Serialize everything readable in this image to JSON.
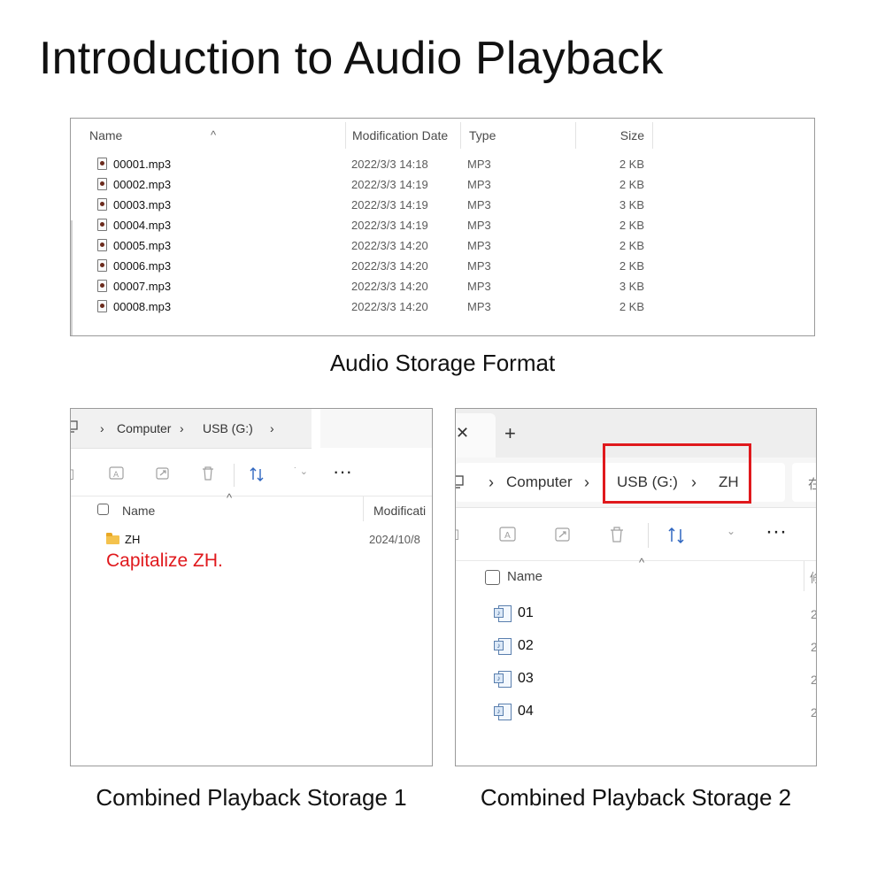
{
  "page_title": "Introduction to Audio Playback",
  "file_list": {
    "columns": {
      "name": "Name",
      "date": "Modification Date",
      "type": "Type",
      "size": "Size"
    },
    "rows": [
      {
        "name": "00001.mp3",
        "date": "2022/3/3 14:18",
        "type": "MP3",
        "size": "2 KB"
      },
      {
        "name": "00002.mp3",
        "date": "2022/3/3 14:19",
        "type": "MP3",
        "size": "2 KB"
      },
      {
        "name": "00003.mp3",
        "date": "2022/3/3 14:19",
        "type": "MP3",
        "size": "3 KB"
      },
      {
        "name": "00004.mp3",
        "date": "2022/3/3 14:19",
        "type": "MP3",
        "size": "2 KB"
      },
      {
        "name": "00005.mp3",
        "date": "2022/3/3 14:20",
        "type": "MP3",
        "size": "2 KB"
      },
      {
        "name": "00006.mp3",
        "date": "2022/3/3 14:20",
        "type": "MP3",
        "size": "2 KB"
      },
      {
        "name": "00007.mp3",
        "date": "2022/3/3 14:20",
        "type": "MP3",
        "size": "3 KB"
      },
      {
        "name": "00008.mp3",
        "date": "2022/3/3 14:20",
        "type": "MP3",
        "size": "2 KB"
      }
    ],
    "caption": "Audio Storage Format"
  },
  "storage1": {
    "breadcrumb": [
      "Computer",
      "USB (G:)"
    ],
    "column_name": "Name",
    "column_modified": "Modificati",
    "folder": {
      "name": "ZH",
      "date": "2024/10/8"
    },
    "note": "Capitalize ZH.",
    "caption": "Combined Playback Storage 1"
  },
  "storage2": {
    "breadcrumb": [
      "Computer",
      "USB (G:)",
      "ZH"
    ],
    "column_name": "Name",
    "column_cut": "修",
    "files": [
      "01",
      "02",
      "03",
      "04"
    ],
    "addr_cut": "在",
    "caption": "Combined Playback Storage 2"
  },
  "colors": {
    "highlight": "#e0191d",
    "note": "#e0191d"
  }
}
